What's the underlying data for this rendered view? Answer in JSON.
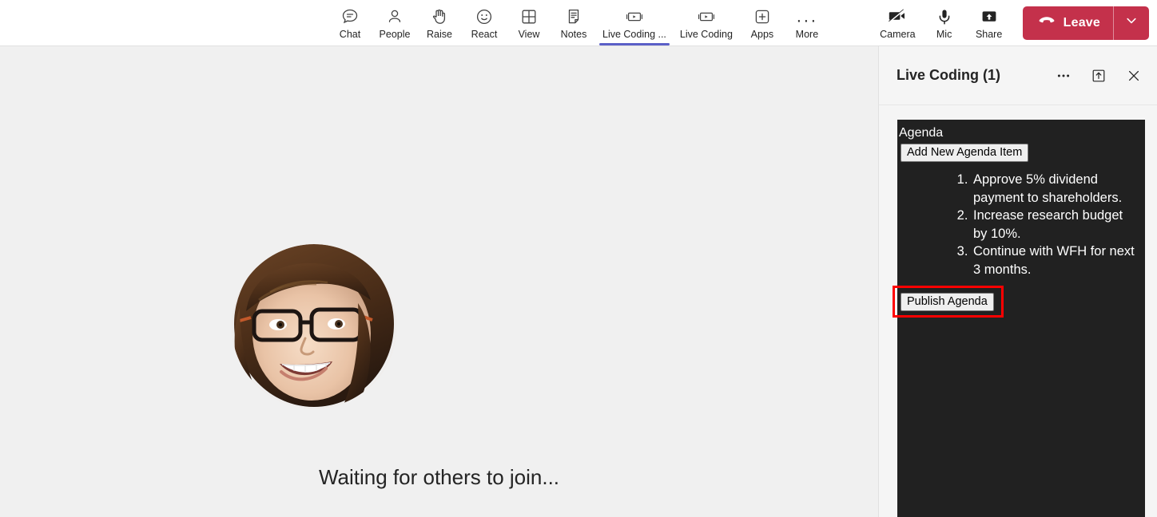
{
  "toolbar": {
    "items": [
      {
        "label": "Chat",
        "icon": "chat-icon",
        "active": false
      },
      {
        "label": "People",
        "icon": "people-icon",
        "active": false
      },
      {
        "label": "Raise",
        "icon": "raise-hand-icon",
        "active": false
      },
      {
        "label": "React",
        "icon": "react-smiley-icon",
        "active": false
      },
      {
        "label": "View",
        "icon": "view-grid-icon",
        "active": false
      },
      {
        "label": "Notes",
        "icon": "notes-icon",
        "active": false
      },
      {
        "label": "Live Coding ...",
        "icon": "live-coding-app-icon",
        "active": true
      },
      {
        "label": "Live Coding",
        "icon": "live-coding-app-icon",
        "active": false
      },
      {
        "label": "Apps",
        "icon": "plus-square-icon",
        "active": false
      },
      {
        "label": "More",
        "icon": "more-ellipsis-icon",
        "active": false
      }
    ],
    "right_items": [
      {
        "label": "Camera",
        "icon": "camera-off-icon"
      },
      {
        "label": "Mic",
        "icon": "microphone-icon"
      },
      {
        "label": "Share",
        "icon": "share-up-arrow-icon"
      }
    ],
    "leave": {
      "label": "Leave",
      "icon": "hangup-phone-icon",
      "chevron_icon": "chevron-down-icon",
      "color": "#c4314b"
    },
    "active_underline_color": "#5b5fc7"
  },
  "stage": {
    "status_text": "Waiting for others to join...",
    "avatar_name": "participant-avatar",
    "background": "#f0f0f0"
  },
  "panel": {
    "title": "Live Coding (1)",
    "actions": [
      {
        "name": "more-options-icon",
        "glyph": "···"
      },
      {
        "name": "popout-icon",
        "glyph": "↑"
      },
      {
        "name": "close-icon",
        "glyph": "×"
      }
    ],
    "app": {
      "background": "#212121",
      "heading": "Agenda",
      "add_button_label": "Add New Agenda Item",
      "agenda_items": [
        "Approve 5% dividend payment to shareholders.",
        "Increase research budget by 10%.",
        "Continue with WFH for next 3 months."
      ],
      "publish_button_label": "Publish Agenda"
    }
  },
  "annotation": {
    "name": "publish-agenda-highlight",
    "color": "#ff0000",
    "target": "Publish Agenda"
  }
}
